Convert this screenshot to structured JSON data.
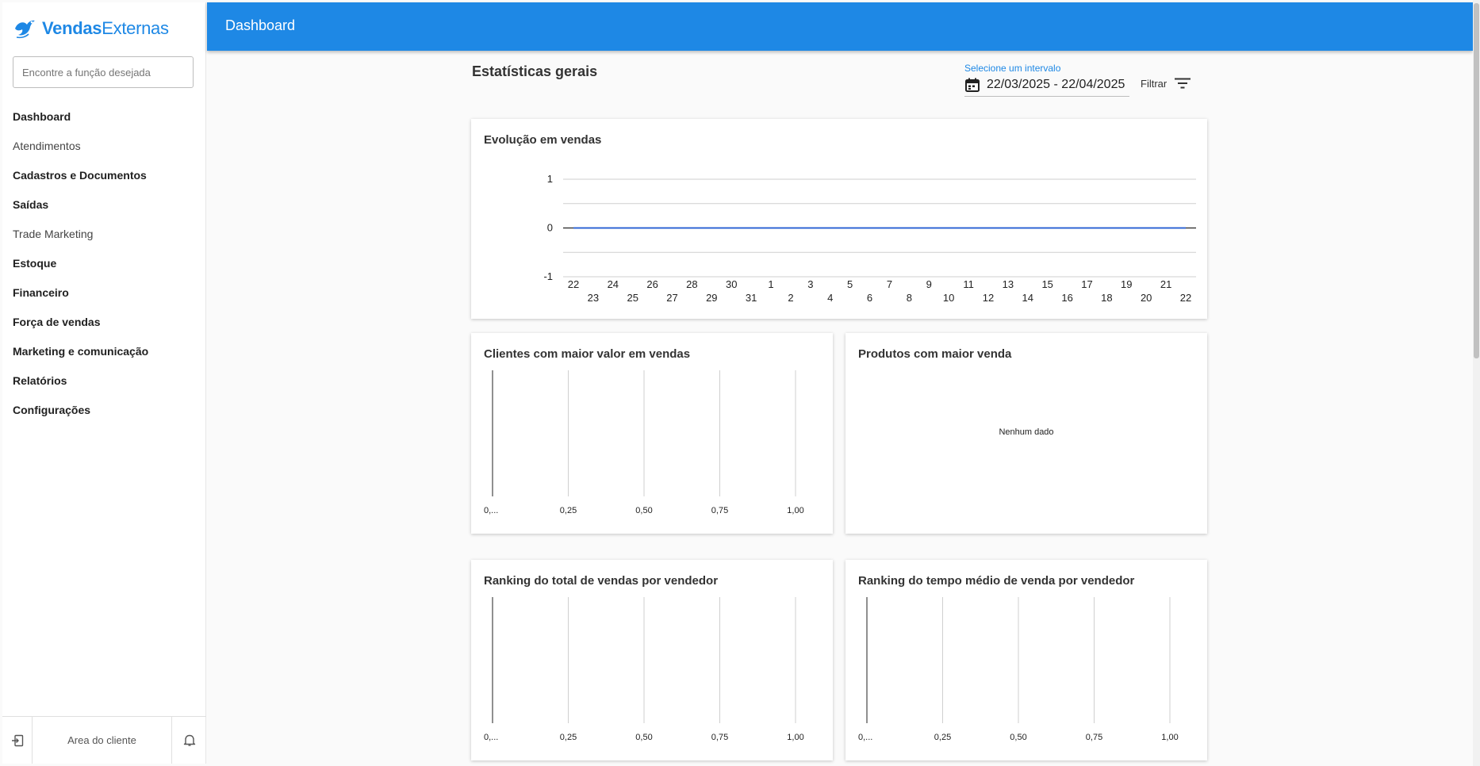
{
  "app": {
    "brand_bold": "Vendas",
    "brand_regular": "Externas",
    "page_title": "Dashboard"
  },
  "sidebar": {
    "search_placeholder": "Encontre a função desejada",
    "items": [
      {
        "label": "Dashboard",
        "bold": true
      },
      {
        "label": "Atendimentos",
        "bold": false
      },
      {
        "label": "Cadastros e Documentos",
        "bold": true
      },
      {
        "label": "Saídas",
        "bold": true
      },
      {
        "label": "Trade Marketing",
        "bold": false
      },
      {
        "label": "Estoque",
        "bold": true
      },
      {
        "label": "Financeiro",
        "bold": true
      },
      {
        "label": "Força de vendas",
        "bold": true
      },
      {
        "label": "Marketing e comunicação",
        "bold": true
      },
      {
        "label": "Relatórios",
        "bold": true
      },
      {
        "label": "Configurações",
        "bold": true
      }
    ],
    "footer": {
      "client_area": "Area do cliente",
      "logout_icon": "logout-icon",
      "bell_icon": "bell-icon"
    }
  },
  "main": {
    "section_title": "Estatísticas gerais",
    "date_range": {
      "label": "Selecione um intervalo",
      "value": "22/03/2025 - 22/04/2025"
    },
    "filter_label": "Filtrar"
  },
  "colors": {
    "primary": "#1e88e5",
    "line": "#1e5ad6"
  },
  "chart_data": [
    {
      "id": "evolucao",
      "type": "line",
      "title": "Evolução em vendas",
      "x": [
        "22",
        "23",
        "24",
        "25",
        "26",
        "27",
        "28",
        "29",
        "30",
        "31",
        "1",
        "2",
        "3",
        "4",
        "5",
        "6",
        "7",
        "8",
        "9",
        "10",
        "11",
        "12",
        "13",
        "14",
        "15",
        "16",
        "17",
        "18",
        "19",
        "20",
        "21",
        "22"
      ],
      "series": [
        {
          "values": [
            0,
            0,
            0,
            0,
            0,
            0,
            0,
            0,
            0,
            0,
            0,
            0,
            0,
            0,
            0,
            0,
            0,
            0,
            0,
            0,
            0,
            0,
            0,
            0,
            0,
            0,
            0,
            0,
            0,
            0,
            0,
            0
          ]
        }
      ],
      "y_ticks": [
        "1",
        "0",
        "-1"
      ],
      "ylim": [
        -1,
        1
      ],
      "grid": true
    },
    {
      "id": "clientes",
      "type": "bar",
      "title": "Clientes com maior valor em vendas",
      "categories": [],
      "values": [],
      "x_ticks": [
        "0,...",
        "0,25",
        "0,50",
        "0,75",
        "1,00"
      ],
      "xlim": [
        0,
        1
      ]
    },
    {
      "id": "produtos",
      "type": "bar",
      "title": "Produtos com maior venda",
      "categories": [],
      "values": [],
      "empty_message": "Nenhum dado"
    },
    {
      "id": "ranking_total",
      "type": "bar",
      "title": "Ranking do total de vendas por vendedor",
      "categories": [],
      "values": [],
      "x_ticks": [
        "0,...",
        "0,25",
        "0,50",
        "0,75",
        "1,00"
      ],
      "xlim": [
        0,
        1
      ]
    },
    {
      "id": "ranking_tempo",
      "type": "bar",
      "title": "Ranking do tempo médio de venda por vendedor",
      "categories": [],
      "values": [],
      "x_ticks": [
        "0,...",
        "0,25",
        "0,50",
        "0,75",
        "1,00"
      ],
      "xlim": [
        0,
        1
      ]
    }
  ]
}
